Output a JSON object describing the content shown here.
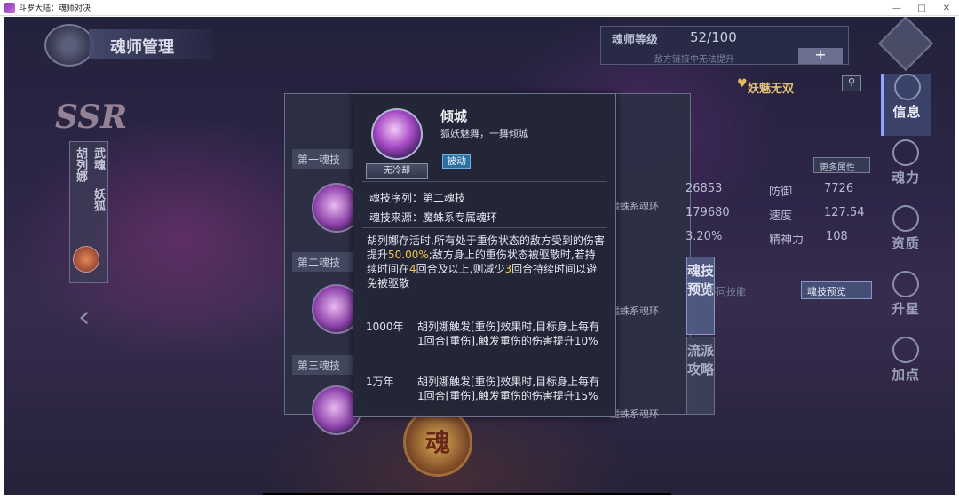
{
  "window": {
    "title": "斗罗大陆：魂师对决"
  },
  "header": {
    "title": "魂师管理"
  },
  "level": {
    "label": "魂师等级",
    "value": "52/100",
    "note": "敌方链接中无法提升",
    "plus": "+"
  },
  "sidebar": {
    "items": [
      {
        "label": "信息",
        "icon": "info-icon",
        "active": true
      },
      {
        "label": "魂力",
        "icon": "soul-power-icon",
        "active": false
      },
      {
        "label": "资质",
        "icon": "aptitude-icon",
        "active": false
      },
      {
        "label": "升星",
        "icon": "star-up-icon",
        "active": false
      },
      {
        "label": "加点",
        "icon": "add-point-icon",
        "active": false
      }
    ]
  },
  "character": {
    "rarity": "SSR",
    "name": "胡列娜",
    "spirit_label": "武魂",
    "spirit_value": "妖狐",
    "title": "妖魅无双"
  },
  "skills": {
    "categories": [
      "第一魂技",
      "第二魂技",
      "第三魂技"
    ],
    "ring_label": "魔蛛系魂环",
    "diff_note": "不同技能",
    "preview_btn": "魂技预览",
    "tab_preview": "魂技预览",
    "tab_school": "流派攻略"
  },
  "stats": {
    "more": "更多属性",
    "left_values": [
      "26853",
      "179680",
      "3.20%"
    ],
    "right": [
      {
        "name": "防御",
        "value": "7726"
      },
      {
        "name": "速度",
        "value": "127.54"
      },
      {
        "name": "精神力",
        "value": "108"
      }
    ]
  },
  "bottom_emblem": "魂",
  "tooltip": {
    "cooldown": "无冷却",
    "name": "倾城",
    "desc": "狐妖魅舞，一舞倾城",
    "type": "被动",
    "sequence": "魂技序列：第二魂技",
    "source": "魂技来源：魔蛛系专属魂环",
    "body_1": "胡列娜存活时,所有处于重伤状态的敌方受到的伤害提升",
    "body_hl1": "50.00%",
    "body_2": ";敌方身上的重伤状态被驱散时,若持续时间在",
    "body_hl2": "4",
    "body_3": "回合及以上,则减少",
    "body_hl3": "3",
    "body_4": "回合持续时间以避免被驱散",
    "tiers": [
      {
        "year": "1000年",
        "text": "胡列娜触发[重伤]效果时,目标身上每有1回合[重伤],触发重伤的伤害提升10%"
      },
      {
        "year": "1万年",
        "text": "胡列娜触发[重伤]效果时,目标身上每有1回合[重伤],触发重伤的伤害提升15%"
      }
    ]
  }
}
